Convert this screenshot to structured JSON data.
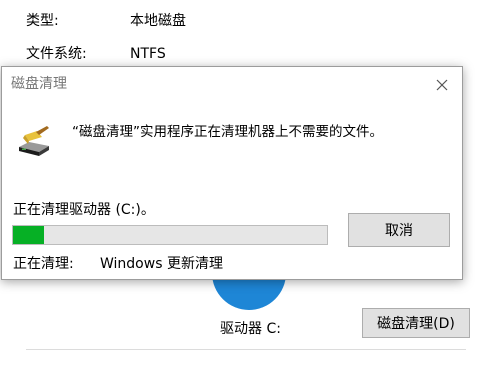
{
  "background_window": {
    "properties": [
      {
        "label": "类型:",
        "value": "本地磁盘"
      },
      {
        "label": "文件系统:",
        "value": "NTFS"
      }
    ],
    "drive_label": "驱动器 C:",
    "disk_cleanup_button": "磁盘清理(D)"
  },
  "dialog": {
    "title": "磁盘清理",
    "close_icon": "close-icon",
    "app_icon": "disk-cleanup-icon",
    "message": "“磁盘清理”实用程序正在清理机器上不需要的文件。",
    "status": "正在清理驱动器 (C:)。",
    "progress": 0.1,
    "progress_color": "#06b025",
    "cancel_button": "取消",
    "cleaning_label": "正在清理:",
    "cleaning_value": "Windows 更新清理"
  }
}
